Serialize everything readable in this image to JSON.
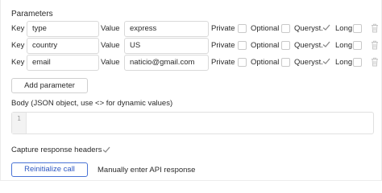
{
  "section_title": "Parameters",
  "param_labels": {
    "key": "Key",
    "value": "Value",
    "private": "Private",
    "optional": "Optional",
    "querystring": "Queryst.",
    "long": "Long"
  },
  "parameters": [
    {
      "key": "type",
      "value": "express",
      "private": false,
      "optional": false,
      "querystring": true,
      "long": false
    },
    {
      "key": "country",
      "value": "US",
      "private": false,
      "optional": false,
      "querystring": true,
      "long": false
    },
    {
      "key": "email",
      "value": "naticio@gmail.com",
      "private": false,
      "optional": false,
      "querystring": true,
      "long": false
    }
  ],
  "add_parameter_label": "Add parameter",
  "body_label": "(JSON object, use <> for dynamic values)",
  "body_prefix": "Body",
  "body_line_number": "1",
  "body_value": "",
  "capture_headers_label": "Capture response headers",
  "capture_headers_checked": true,
  "reinitialize_label": "Reinitialize call",
  "manual_label": "Manually enter API response",
  "colors": {
    "accent": "#2e58c2",
    "check": "#8a8a8a",
    "trash": "#c4c4c4"
  },
  "icons": {
    "check": "check-icon",
    "trash": "trash-icon"
  }
}
